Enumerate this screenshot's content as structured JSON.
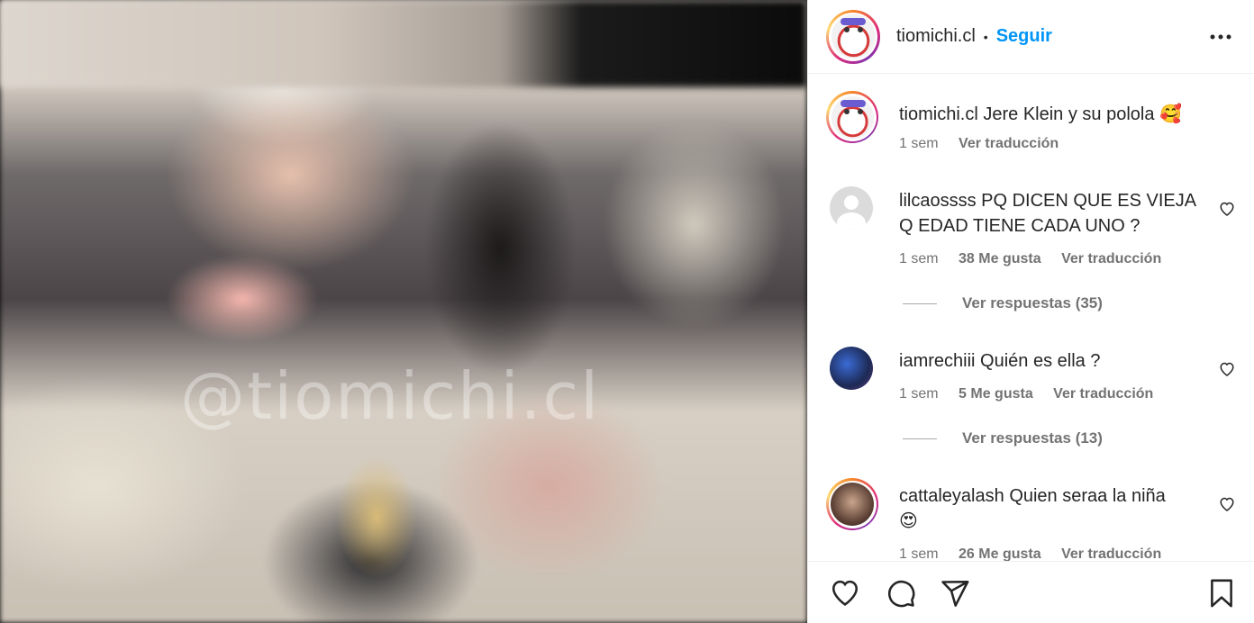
{
  "media": {
    "watermark": "@tiomichi.cl"
  },
  "header": {
    "username": "tiomichi.cl",
    "separator": "•",
    "follow_label": "Seguir"
  },
  "caption": {
    "username": "tiomichi.cl",
    "text": "Jere Klein y su polola",
    "emoji": "🥰",
    "time": "1 sem",
    "translate": "Ver traducción"
  },
  "comments": [
    {
      "username": "lilcaossss",
      "text": "PQ DICEN QUE ES VIEJA Q EDAD TIENE CADA UNO ?",
      "time": "1 sem",
      "likes": "38 Me gusta",
      "translate": "Ver traducción",
      "replies": "Ver respuestas (35)"
    },
    {
      "username": "iamrechiii",
      "text": "Quién es ella ?",
      "time": "1 sem",
      "likes": "5 Me gusta",
      "translate": "Ver traducción",
      "replies": "Ver respuestas (13)"
    },
    {
      "username": "cattaleyalash",
      "text": "Quien seraa la niña",
      "emoji": "😍",
      "time": "1 sem",
      "likes": "26 Me gusta",
      "translate": "Ver traducción"
    }
  ],
  "icons": {
    "more": "more-icon",
    "like": "heart-icon",
    "comment": "comment-icon",
    "share": "share-icon",
    "save": "bookmark-icon"
  },
  "colors": {
    "accent": "#0095f6",
    "secondary_text": "#737373",
    "primary_text": "#262626"
  }
}
